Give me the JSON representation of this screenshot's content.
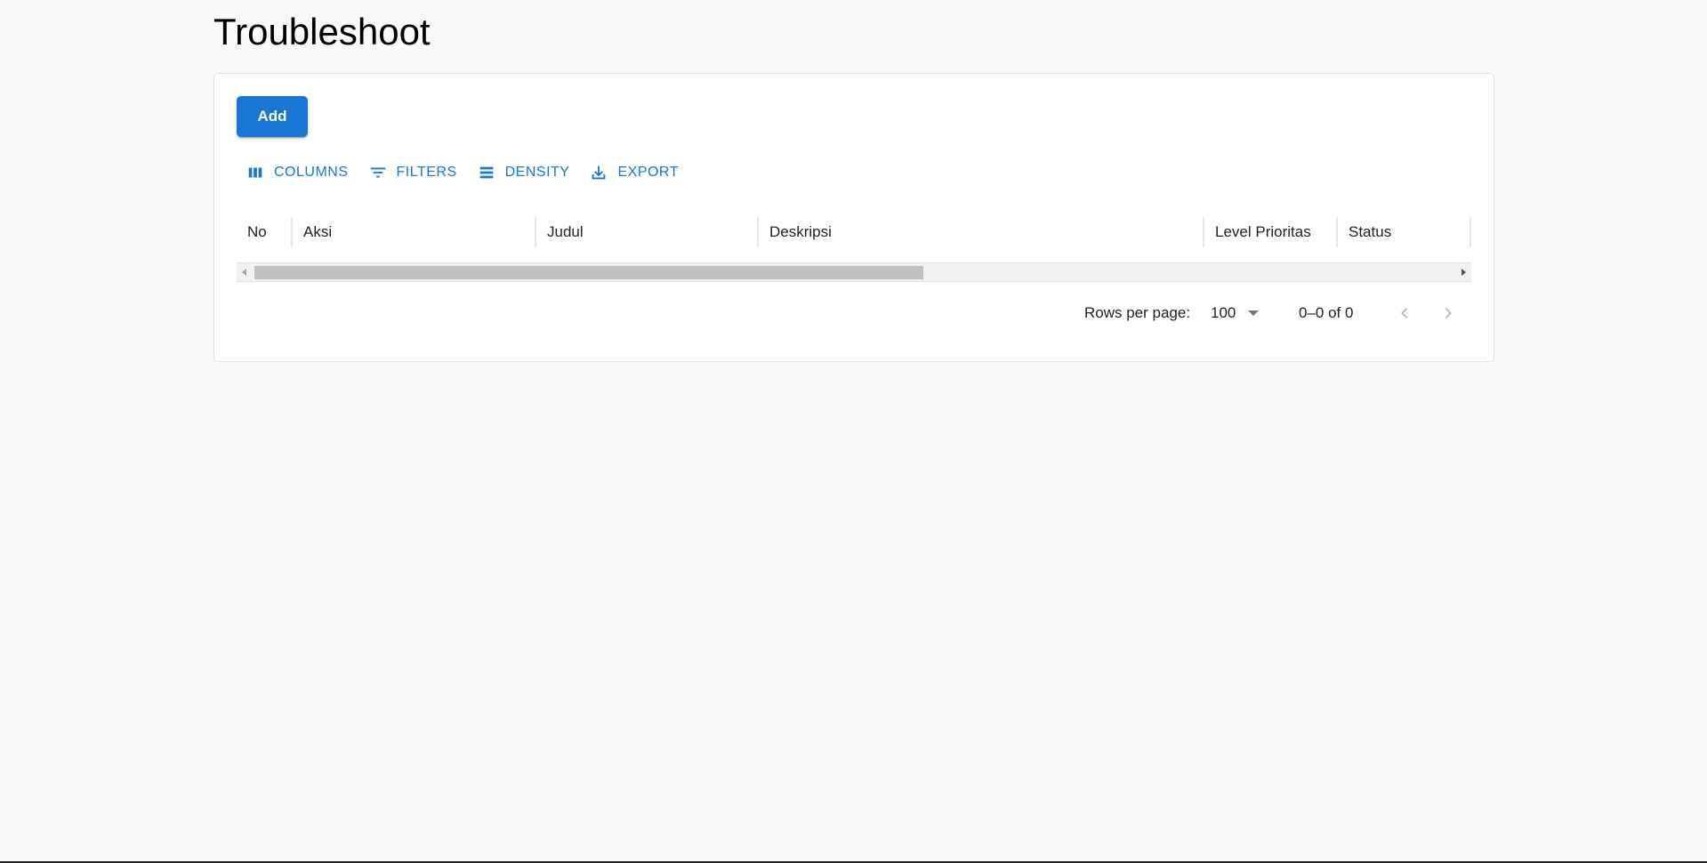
{
  "page": {
    "title": "Troubleshoot"
  },
  "toolbar": {
    "add_label": "Add",
    "columns_label": "COLUMNS",
    "filters_label": "FILTERS",
    "density_label": "DENSITY",
    "export_label": "EXPORT"
  },
  "table": {
    "columns": [
      "No",
      "Aksi",
      "Judul",
      "Deskripsi",
      "Level Prioritas",
      "Status"
    ],
    "rows": []
  },
  "pagination": {
    "rows_per_page_label": "Rows per page:",
    "rows_per_page_value": "100",
    "range_label": "0–0 of 0"
  },
  "colors": {
    "accent": "#1976d2",
    "background": "#fafafa"
  }
}
